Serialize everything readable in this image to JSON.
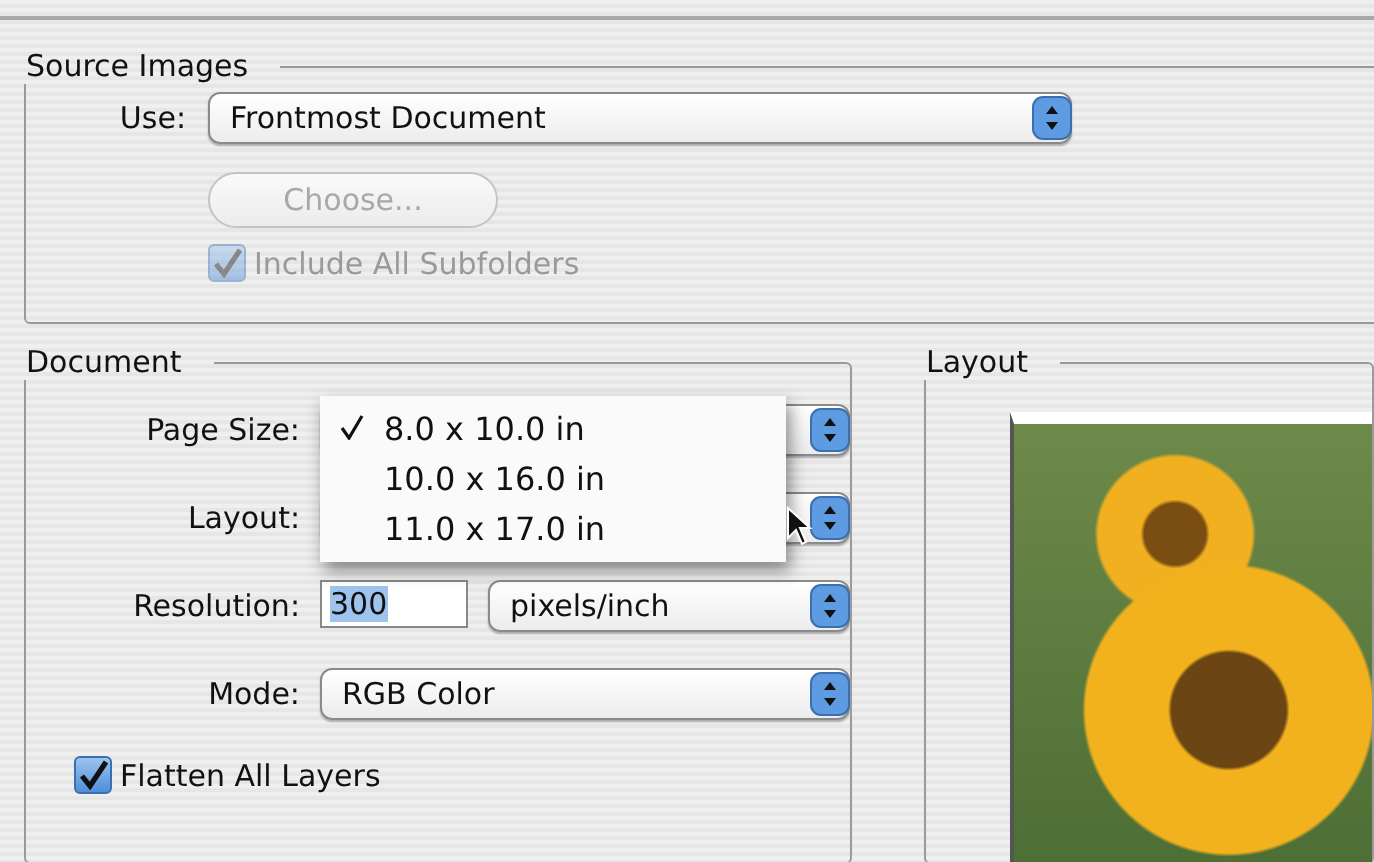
{
  "source_images": {
    "title": "Source Images",
    "use": {
      "label": "Use:",
      "value": "Frontmost Document"
    },
    "choose_button": {
      "label": "Choose...",
      "disabled": true
    },
    "include_subfolders": {
      "label": "Include All Subfolders",
      "checked": true,
      "disabled": true
    }
  },
  "document": {
    "title": "Document",
    "rows": [
      {
        "kind": "popup",
        "label": "Page Size:"
      },
      {
        "kind": "popup",
        "label": "Layout:"
      },
      {
        "kind": "field_unit",
        "label": "Resolution:",
        "value": "300",
        "unit": "pixels/inch"
      },
      {
        "kind": "popup",
        "label": "Mode:",
        "value": "RGB Color"
      }
    ],
    "page_size_menu": [
      {
        "label": "8.0 x 10.0 in",
        "selected": true
      },
      {
        "label": "10.0 x 16.0 in",
        "selected": false
      },
      {
        "label": "11.0 x 17.0 in",
        "selected": false
      }
    ],
    "flatten_layers": {
      "label": "Flatten All Layers",
      "checked": true
    }
  },
  "layout_panel": {
    "title": "Layout"
  }
}
